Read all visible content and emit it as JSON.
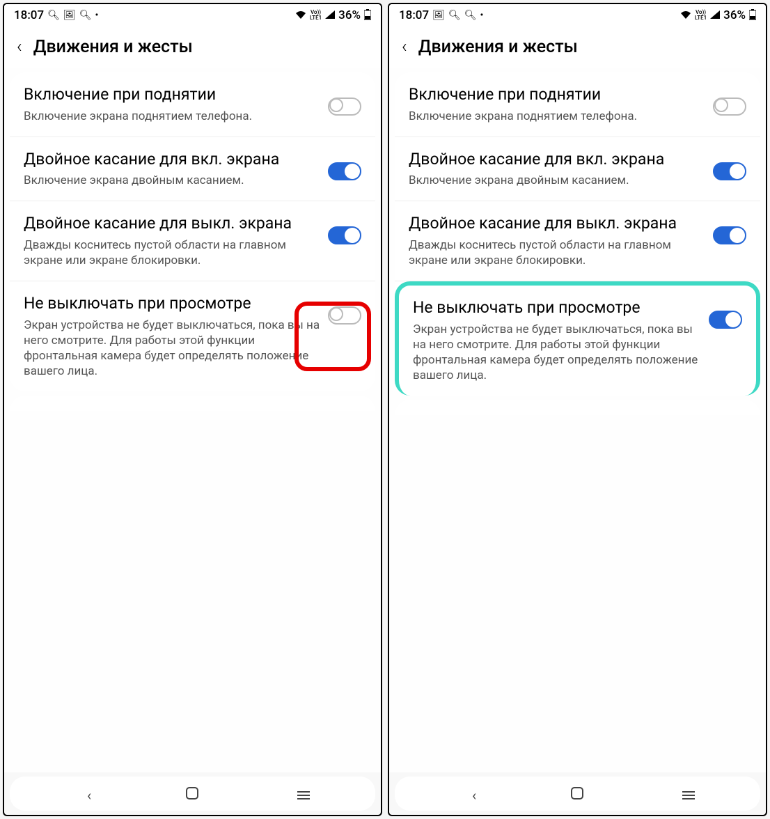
{
  "status": {
    "time": "18:07",
    "battery": "36%",
    "volte": "Vo))\nLTE1"
  },
  "header": {
    "title": "Движения и жесты"
  },
  "settings": [
    {
      "title": "Включение при поднятии",
      "desc": "Включение экрана поднятием телефона.",
      "on_left": false,
      "on_right": false
    },
    {
      "title": "Двойное касание для вкл. экрана",
      "desc": "Включение экрана двойным касанием.",
      "on_left": true,
      "on_right": true
    },
    {
      "title": "Двойное касание для выкл. экрана",
      "desc": "Дважды коснитесь пустой области на главном экране или экране блокировки.",
      "on_left": true,
      "on_right": true
    },
    {
      "title": "Не выключать при просмотре",
      "desc": "Экран устройства не будет выключаться, пока вы на него смотрите. Для работы этой функции фронтальная камера будет определять положение вашего лица.",
      "on_left": false,
      "on_right": true
    }
  ],
  "icons": {
    "search": "🔍︎",
    "picture": "🖼",
    "wifi": "📶",
    "signal": "📶",
    "battery": "🔋",
    "dot": "•"
  }
}
